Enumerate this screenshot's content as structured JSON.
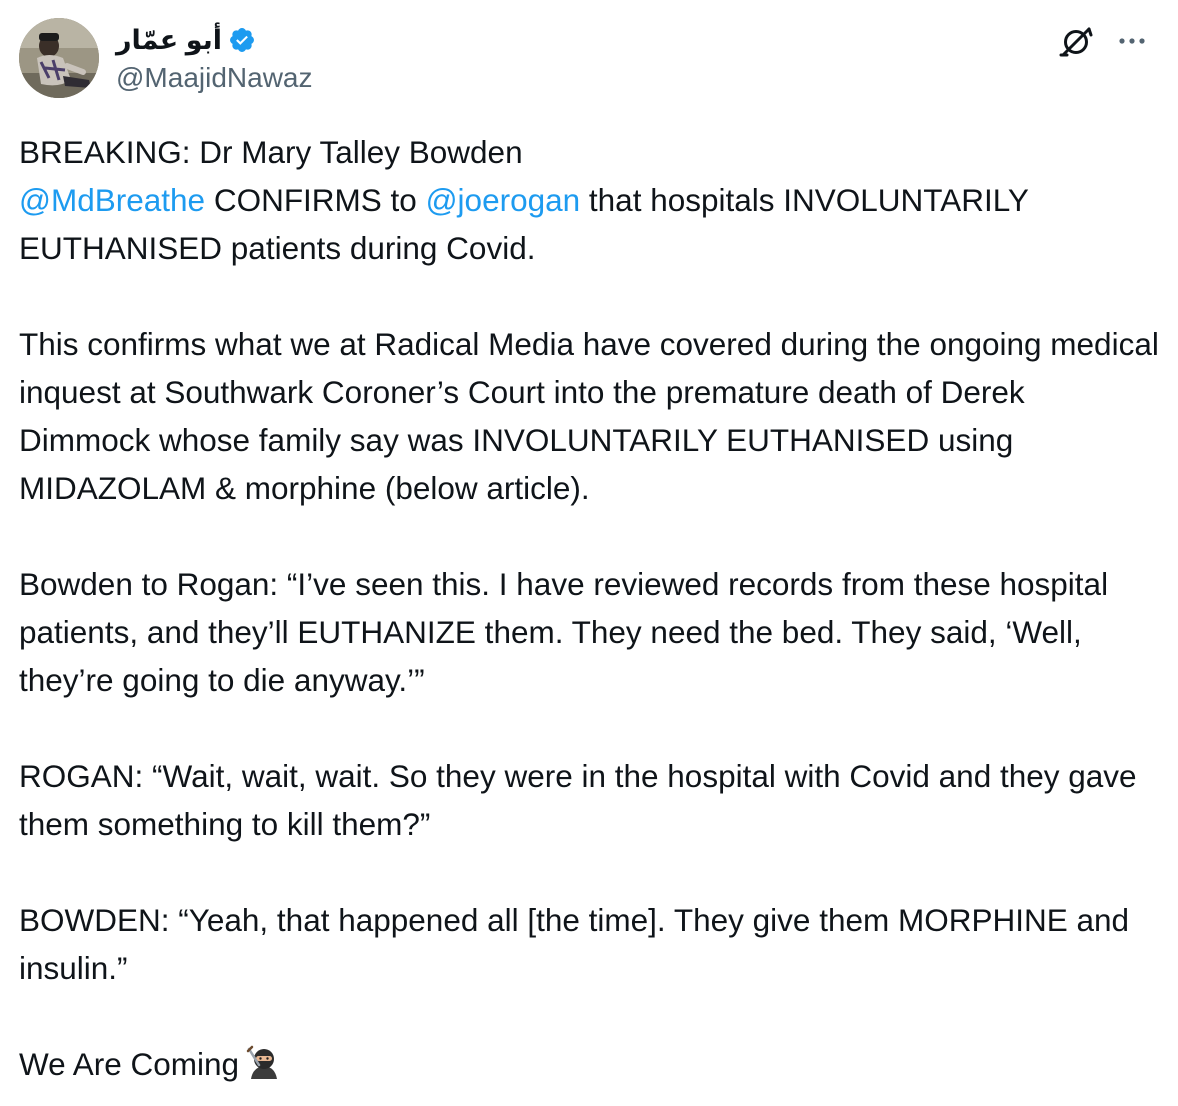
{
  "author": {
    "display_name": "أبو عمّار",
    "handle": "@MaajidNawaz",
    "verified": true,
    "avatar_icon": "avatar-photo",
    "verified_color": "#1d9bf0"
  },
  "actions": {
    "grok_icon": "grok-icon",
    "more_icon": "more-dots-icon"
  },
  "tweet": {
    "p1_line1": "BREAKING: Dr Mary Talley Bowden",
    "mention1": "@MdBreathe",
    "p1_mid": " CONFIRMS to ",
    "mention2": "@joerogan",
    "p1_rest": " that hospitals INVOLUNTARILY EUTHANISED patients during Covid.",
    "p2": "This confirms what we at Radical Media have covered during the ongoing medical inquest at Southwark Coroner’s Court into the premature death of Derek Dimmock whose family say was INVOLUNTARILY EUTHANISED using MIDAZOLAM & morphine (below article).",
    "p3": "Bowden to Rogan: “I’ve seen this. I have reviewed records from these hospital patients, and they’ll EUTHANIZE them. They need the bed. They said, ‘Well, they’re going to die anyway.’”",
    "p4": "ROGAN: “Wait, wait, wait. So they were in the hospital with Covid and they gave them something to kill them?”",
    "p5": "BOWDEN: “Yeah, that happened all [the time]. They give them MORPHINE and insulin.”",
    "p6": "We Are Coming",
    "p6_emoji": "ninja-icon"
  },
  "colors": {
    "text": "#0f1419",
    "secondary": "#536471",
    "link": "#1d9bf0"
  }
}
